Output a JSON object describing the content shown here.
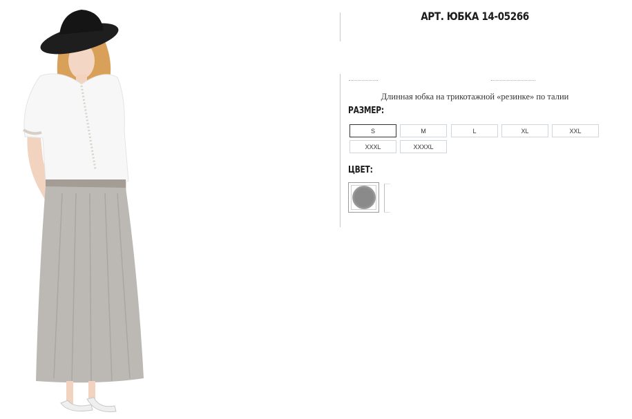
{
  "product": {
    "title": "АРТ. ЮБКА 14-05266",
    "description": "Длинная юбка на трикотажной «резинке» по талии"
  },
  "sizes": {
    "label": "РАЗМЕР:",
    "options": [
      "S",
      "M",
      "L",
      "XL",
      "XXL",
      "XXXL",
      "XXXXL"
    ],
    "selected": "S"
  },
  "colors": {
    "label": "ЦВЕТ:",
    "swatch_colors": [
      "#8a8a8a"
    ]
  },
  "photo": {
    "icon": "model-photo"
  }
}
